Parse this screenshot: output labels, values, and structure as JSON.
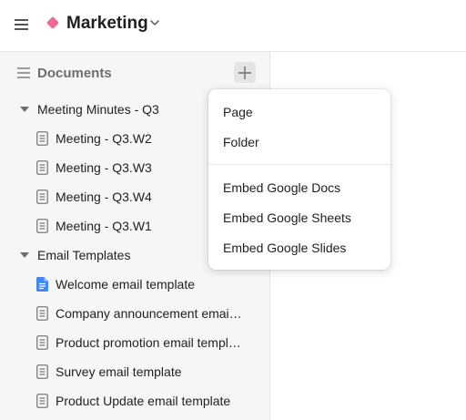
{
  "header": {
    "workspace_title": "Marketing",
    "workspace_color": "#f06a99",
    "icons": [
      "hamburger-menu-icon",
      "diamond-icon",
      "chevron-down-icon"
    ]
  },
  "sidebar": {
    "section_title": "Documents",
    "icons": [
      "list-icon",
      "plus-icon"
    ],
    "folders": [
      {
        "label": "Meeting Minutes - Q3",
        "expanded": true,
        "items": [
          {
            "label": "Meeting - Q3.W2",
            "icon": "document-icon"
          },
          {
            "label": "Meeting - Q3.W3",
            "icon": "document-icon"
          },
          {
            "label": "Meeting - Q3.W4",
            "icon": "document-icon"
          },
          {
            "label": "Meeting - Q3.W1",
            "icon": "document-icon"
          }
        ]
      },
      {
        "label": "Email Templates",
        "expanded": true,
        "items": [
          {
            "label": "Welcome email template",
            "icon": "google-docs-icon"
          },
          {
            "label": "Company announcement email template",
            "icon": "document-icon"
          },
          {
            "label": "Product promotion email template",
            "icon": "document-icon"
          },
          {
            "label": "Survey email template",
            "icon": "document-icon"
          },
          {
            "label": "Product Update email template",
            "icon": "document-icon"
          }
        ]
      }
    ]
  },
  "add_menu": {
    "items": [
      {
        "label": "Page"
      },
      {
        "label": "Folder"
      },
      {
        "label": "Embed Google Docs"
      },
      {
        "label": "Embed Google Sheets"
      },
      {
        "label": "Embed Google Slides"
      }
    ]
  },
  "colors": {
    "accent_pink": "#f06a99",
    "google_docs_blue": "#4285f4",
    "sidebar_bg": "#f6f6f6"
  }
}
